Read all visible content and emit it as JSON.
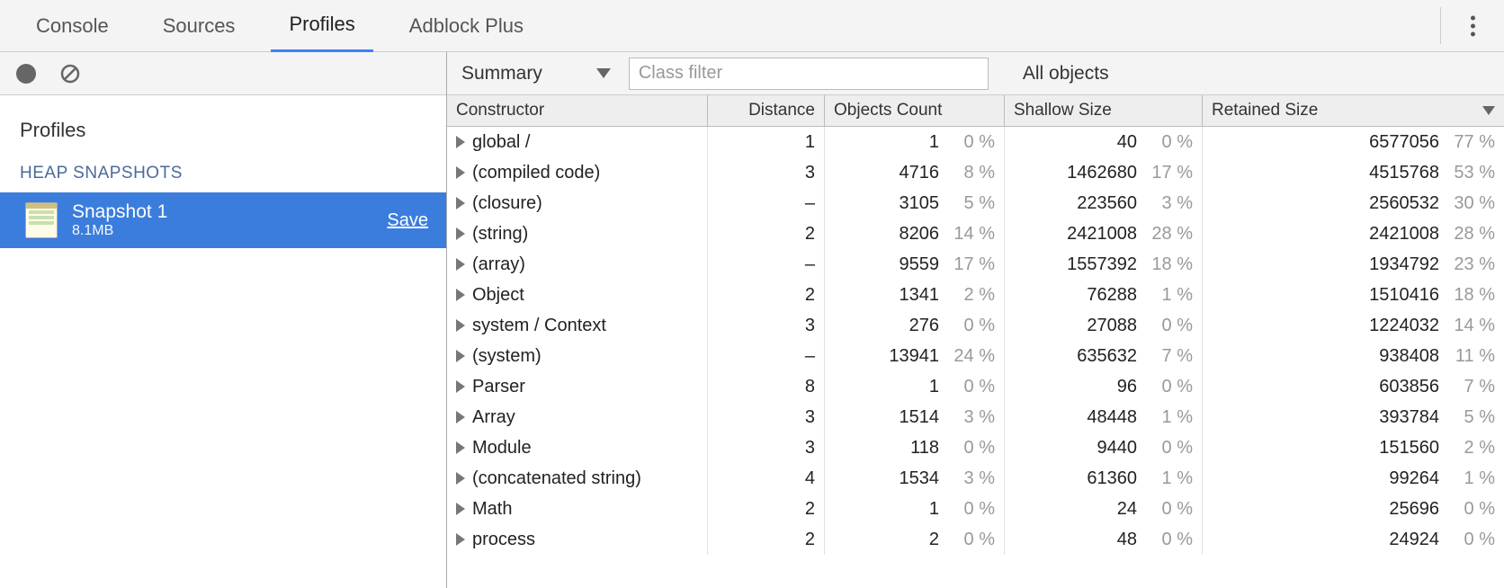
{
  "tabs": {
    "console": "Console",
    "sources": "Sources",
    "profiles": "Profiles",
    "adblock": "Adblock Plus"
  },
  "sidebar": {
    "heading": "Profiles",
    "section": "HEAP SNAPSHOTS",
    "snapshot": {
      "title": "Snapshot 1",
      "size": "8.1MB",
      "save": "Save"
    }
  },
  "toolbar": {
    "view": "Summary",
    "filter_placeholder": "Class filter",
    "scope": "All objects"
  },
  "columns": {
    "constructor": "Constructor",
    "distance": "Distance",
    "count": "Objects Count",
    "shallow": "Shallow Size",
    "retained": "Retained Size"
  },
  "rows": [
    {
      "name": "global /",
      "distance": "1",
      "count": "1",
      "count_pct": "0 %",
      "shallow": "40",
      "shallow_pct": "0 %",
      "retained": "6577056",
      "retained_pct": "77 %"
    },
    {
      "name": "(compiled code)",
      "distance": "3",
      "count": "4716",
      "count_pct": "8 %",
      "shallow": "1462680",
      "shallow_pct": "17 %",
      "retained": "4515768",
      "retained_pct": "53 %"
    },
    {
      "name": "(closure)",
      "distance": "–",
      "count": "3105",
      "count_pct": "5 %",
      "shallow": "223560",
      "shallow_pct": "3 %",
      "retained": "2560532",
      "retained_pct": "30 %"
    },
    {
      "name": "(string)",
      "distance": "2",
      "count": "8206",
      "count_pct": "14 %",
      "shallow": "2421008",
      "shallow_pct": "28 %",
      "retained": "2421008",
      "retained_pct": "28 %"
    },
    {
      "name": "(array)",
      "distance": "–",
      "count": "9559",
      "count_pct": "17 %",
      "shallow": "1557392",
      "shallow_pct": "18 %",
      "retained": "1934792",
      "retained_pct": "23 %"
    },
    {
      "name": "Object",
      "distance": "2",
      "count": "1341",
      "count_pct": "2 %",
      "shallow": "76288",
      "shallow_pct": "1 %",
      "retained": "1510416",
      "retained_pct": "18 %"
    },
    {
      "name": "system / Context",
      "distance": "3",
      "count": "276",
      "count_pct": "0 %",
      "shallow": "27088",
      "shallow_pct": "0 %",
      "retained": "1224032",
      "retained_pct": "14 %"
    },
    {
      "name": "(system)",
      "distance": "–",
      "count": "13941",
      "count_pct": "24 %",
      "shallow": "635632",
      "shallow_pct": "7 %",
      "retained": "938408",
      "retained_pct": "11 %"
    },
    {
      "name": "Parser",
      "distance": "8",
      "count": "1",
      "count_pct": "0 %",
      "shallow": "96",
      "shallow_pct": "0 %",
      "retained": "603856",
      "retained_pct": "7 %"
    },
    {
      "name": "Array",
      "distance": "3",
      "count": "1514",
      "count_pct": "3 %",
      "shallow": "48448",
      "shallow_pct": "1 %",
      "retained": "393784",
      "retained_pct": "5 %"
    },
    {
      "name": "Module",
      "distance": "3",
      "count": "118",
      "count_pct": "0 %",
      "shallow": "9440",
      "shallow_pct": "0 %",
      "retained": "151560",
      "retained_pct": "2 %"
    },
    {
      "name": "(concatenated string)",
      "distance": "4",
      "count": "1534",
      "count_pct": "3 %",
      "shallow": "61360",
      "shallow_pct": "1 %",
      "retained": "99264",
      "retained_pct": "1 %"
    },
    {
      "name": "Math",
      "distance": "2",
      "count": "1",
      "count_pct": "0 %",
      "shallow": "24",
      "shallow_pct": "0 %",
      "retained": "25696",
      "retained_pct": "0 %"
    },
    {
      "name": "process",
      "distance": "2",
      "count": "2",
      "count_pct": "0 %",
      "shallow": "48",
      "shallow_pct": "0 %",
      "retained": "24924",
      "retained_pct": "0 %"
    }
  ]
}
